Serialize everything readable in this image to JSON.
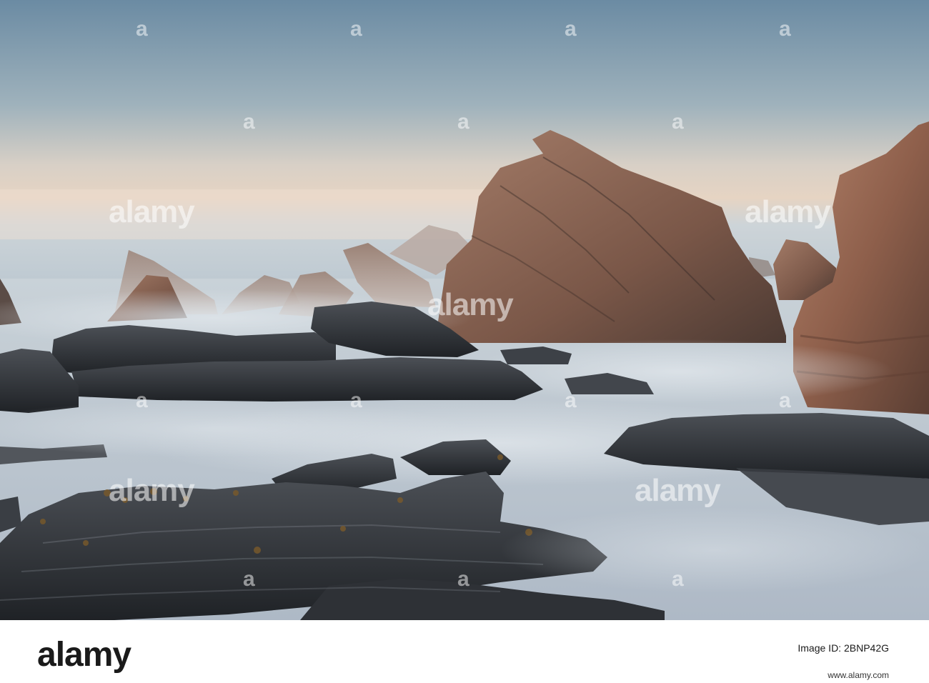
{
  "photo": {
    "subject": "rocky coastline",
    "colors": {
      "sky_top": "#6f8fa6",
      "sky_mid": "#b7c3c6",
      "horizon": "#e9d6c4",
      "sea_mist": "#c7d3dc",
      "rock_dark": "#2c2f33",
      "rock_warm": "#9c6b55"
    }
  },
  "watermark": {
    "text": "alamy"
  },
  "footer": {
    "logo": "alamy",
    "image_id_label": "Image ID: 2BNP42G",
    "image_id": "2BNP42G",
    "site": "www.alamy.com"
  }
}
